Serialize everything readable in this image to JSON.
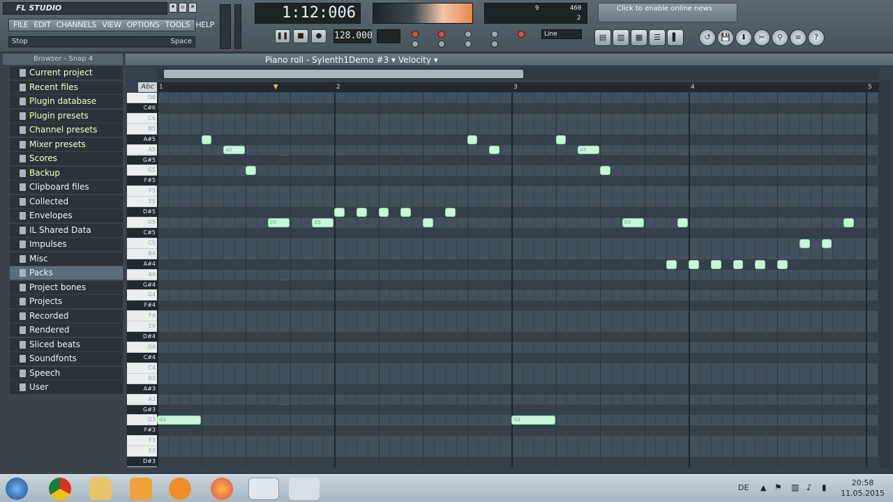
{
  "app": {
    "logo": "FL STUDIO",
    "menu": [
      "FILE",
      "EDIT",
      "CHANNELS",
      "VIEW",
      "OPTIONS",
      "TOOLS",
      "HELP"
    ],
    "hint_left": "Stop",
    "hint_right": "Space",
    "time": "1:12:006",
    "tempo": "128.000",
    "line_mode": "Line",
    "news": "Click to enable online news",
    "cpu_values": [
      "9",
      "460",
      "2"
    ]
  },
  "browser": {
    "title": "Browser - Snap 4",
    "items": [
      {
        "label": "Current project",
        "selected": false
      },
      {
        "label": "Recent files",
        "selected": false
      },
      {
        "label": "Plugin database",
        "selected": false
      },
      {
        "label": "Plugin presets",
        "selected": false
      },
      {
        "label": "Channel presets",
        "selected": false
      },
      {
        "label": "Mixer presets",
        "selected": false
      },
      {
        "label": "Scores",
        "selected": false
      },
      {
        "label": "Backup",
        "selected": false
      },
      {
        "label": "Clipboard files",
        "selected": false
      },
      {
        "label": "Collected",
        "selected": false
      },
      {
        "label": "Envelopes",
        "selected": false
      },
      {
        "label": "IL Shared Data",
        "selected": false
      },
      {
        "label": "Impulses",
        "selected": false
      },
      {
        "label": "Misc",
        "selected": false
      },
      {
        "label": "Packs",
        "selected": true
      },
      {
        "label": "Project bones",
        "selected": false
      },
      {
        "label": "Projects",
        "selected": false
      },
      {
        "label": "Recorded",
        "selected": false
      },
      {
        "label": "Rendered",
        "selected": false
      },
      {
        "label": "Sliced beats",
        "selected": false
      },
      {
        "label": "Soundfonts",
        "selected": false
      },
      {
        "label": "Speech",
        "selected": false
      },
      {
        "label": "User",
        "selected": false
      }
    ]
  },
  "pianoroll": {
    "title": "Piano roll - Sylenth1Demo #3",
    "target": "Velocity",
    "keylabel": "Abc",
    "bars": [
      "1",
      "2",
      "3",
      "4",
      "5"
    ],
    "keys": [
      "D6",
      "C#6",
      "C6",
      "B5",
      "A#5",
      "A5",
      "G#5",
      "G5",
      "F#5",
      "F5",
      "E5",
      "D#5",
      "D5",
      "C#5",
      "C5",
      "B4",
      "A#4",
      "A4",
      "G#4",
      "G4",
      "F#4",
      "F4",
      "E4",
      "D#4",
      "D4",
      "C#4",
      "C4",
      "B3",
      "A#3",
      "A3",
      "G#3",
      "G3",
      "F#3",
      "F3",
      "E3",
      "D#3"
    ],
    "notes": [
      {
        "key": "G3",
        "start": 0,
        "len": 4,
        "label": "G3"
      },
      {
        "key": "A#5",
        "start": 4,
        "len": 1,
        "label": ""
      },
      {
        "key": "A5",
        "start": 6,
        "len": 2,
        "label": "A5"
      },
      {
        "key": "G5",
        "start": 8,
        "len": 1,
        "label": ""
      },
      {
        "key": "D5",
        "start": 10,
        "len": 2,
        "label": "D5"
      },
      {
        "key": "D5",
        "start": 14,
        "len": 2,
        "label": "D5"
      },
      {
        "key": "D#5",
        "start": 16,
        "len": 1,
        "label": ""
      },
      {
        "key": "D#5",
        "start": 18,
        "len": 1,
        "label": ""
      },
      {
        "key": "D#5",
        "start": 20,
        "len": 1,
        "label": ""
      },
      {
        "key": "D#5",
        "start": 22,
        "len": 1,
        "label": ""
      },
      {
        "key": "D5",
        "start": 24,
        "len": 1,
        "label": ""
      },
      {
        "key": "D#5",
        "start": 26,
        "len": 1,
        "label": ""
      },
      {
        "key": "A#5",
        "start": 28,
        "len": 1,
        "label": ""
      },
      {
        "key": "A5",
        "start": 30,
        "len": 1,
        "label": ""
      },
      {
        "key": "G3",
        "start": 32,
        "len": 4,
        "label": "G3"
      },
      {
        "key": "A#5",
        "start": 36,
        "len": 1,
        "label": ""
      },
      {
        "key": "A5",
        "start": 38,
        "len": 2,
        "label": "A5"
      },
      {
        "key": "G5",
        "start": 40,
        "len": 1,
        "label": ""
      },
      {
        "key": "D5",
        "start": 42,
        "len": 2,
        "label": "D5"
      },
      {
        "key": "A#4",
        "start": 46,
        "len": 1,
        "label": ""
      },
      {
        "key": "D5",
        "start": 47,
        "len": 1,
        "label": ""
      },
      {
        "key": "A#4",
        "start": 48,
        "len": 1,
        "label": ""
      },
      {
        "key": "A#4",
        "start": 50,
        "len": 1,
        "label": ""
      },
      {
        "key": "A#4",
        "start": 52,
        "len": 1,
        "label": ""
      },
      {
        "key": "A#4",
        "start": 54,
        "len": 1,
        "label": ""
      },
      {
        "key": "A#4",
        "start": 56,
        "len": 1,
        "label": ""
      },
      {
        "key": "C5",
        "start": 58,
        "len": 1,
        "label": ""
      },
      {
        "key": "C5",
        "start": 60,
        "len": 1,
        "label": ""
      },
      {
        "key": "D5",
        "start": 62,
        "len": 1,
        "label": ""
      }
    ]
  },
  "taskbar": {
    "lang": "DE",
    "time": "20:58",
    "date": "11.05.2015"
  }
}
